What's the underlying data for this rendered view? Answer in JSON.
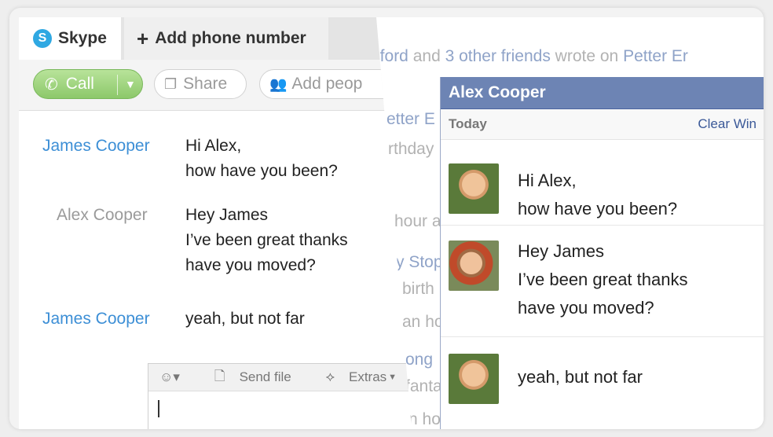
{
  "skype": {
    "tabs": [
      {
        "label": "Skype"
      },
      {
        "label": "Add phone number"
      }
    ],
    "toolbar": {
      "call_label": "Call",
      "share_label": "Share",
      "add_people_label": "Add peop"
    },
    "messages": [
      {
        "sender": "James Cooper",
        "lines": [
          "Hi Alex,",
          "how have you been?"
        ]
      },
      {
        "sender": "Alex Cooper",
        "lines": [
          "Hey James",
          "I’ve been great thanks",
          "have you moved?"
        ]
      },
      {
        "sender": "James Cooper",
        "lines": [
          "yeah, but not far"
        ]
      }
    ],
    "compose": {
      "emoticon_label": "☺▾",
      "send_file_label": "Send file",
      "extras_label": "Extras"
    }
  },
  "facebook_feed": {
    "lines": [
      {
        "parts": [
          {
            "text": "nford",
            "style": "blue"
          },
          {
            "text": " and ",
            "style": "grey"
          },
          {
            "text": "3 other friends",
            "style": "blue"
          },
          {
            "text": " wrote on ",
            "style": "grey"
          },
          {
            "text": "Petter Er",
            "style": "blue"
          }
        ]
      },
      {
        "parts": [
          {
            "text": "etter E",
            "style": "blue"
          }
        ]
      },
      {
        "parts": [
          {
            "text": "rthday",
            "style": "grey"
          }
        ]
      },
      {
        "parts": [
          {
            "text": "hour a",
            "style": "grey"
          }
        ]
      },
      {
        "parts": [
          {
            "text": "y Stop",
            "style": "blue"
          }
        ]
      },
      {
        "parts": [
          {
            "text": "birth",
            "style": "grey"
          }
        ]
      },
      {
        "parts": [
          {
            "text": "an ho",
            "style": "grey"
          }
        ]
      },
      {
        "parts": [
          {
            "text": "ong",
            "style": "blue"
          }
        ]
      },
      {
        "parts": [
          {
            "text": "fanta",
            "style": "grey"
          }
        ]
      },
      {
        "parts": [
          {
            "text": "n ho",
            "style": "grey"
          }
        ]
      }
    ]
  },
  "fb_chat": {
    "title": "Alex Cooper",
    "today_label": "Today",
    "clear_label": "Clear Win",
    "messages": [
      {
        "avatar": "james-avatar",
        "lines": [
          "Hi Alex,",
          "how have you been?"
        ]
      },
      {
        "avatar": "alex-avatar",
        "lines": [
          "Hey James",
          "I’ve been great thanks",
          "have you moved?"
        ]
      },
      {
        "avatar": "james-avatar",
        "lines": [
          "yeah, but not far"
        ]
      }
    ]
  },
  "colors": {
    "skype_link": "#3d8fd6",
    "call_green": "#8cc86a",
    "fb_header": "#6d84b4",
    "fb_link": "#3b5998"
  }
}
